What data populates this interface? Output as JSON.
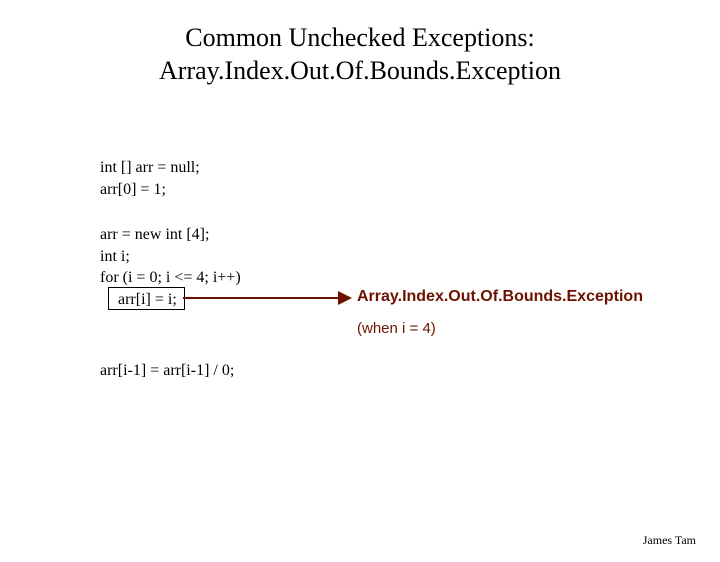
{
  "title": {
    "line1": "Common Unchecked Exceptions:",
    "line2": "Array.Index.Out.Of.Bounds.Exception"
  },
  "code": {
    "b1l1": "int [] arr = null;",
    "b1l2": "arr[0] = 1;",
    "b2l1": "arr = new int [4];",
    "b2l2": "int i;",
    "b2l3": "for (i = 0; i <= 4; i++)",
    "b2l4": "arr[i] = i;",
    "b3l1": "arr[i-1] = arr[i-1] / 0;"
  },
  "callout": {
    "main": "Array.Index.Out.Of.Bounds.Exception",
    "sub": "(when i = 4)"
  },
  "footer": "James Tam"
}
